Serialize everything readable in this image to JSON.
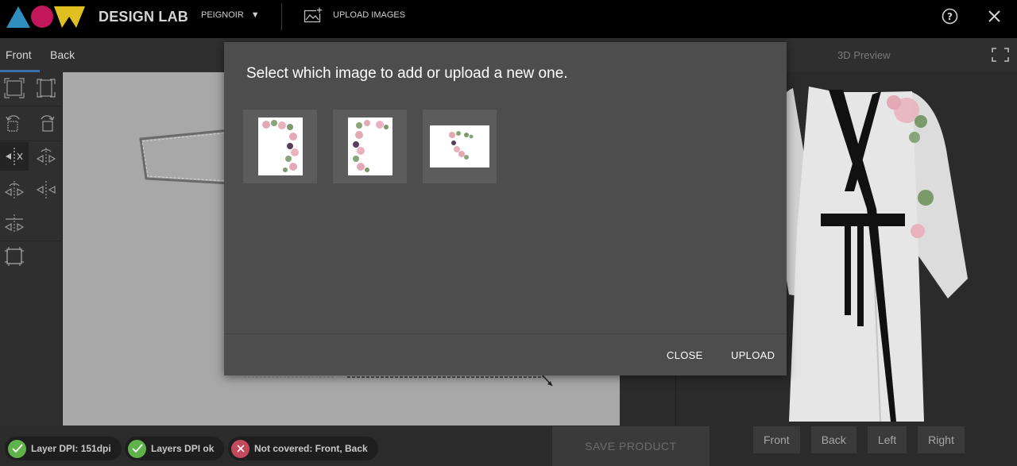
{
  "app": {
    "brand": "DESIGN LAB",
    "product": "PEIGNOIR",
    "upload_images": "UPLOAD IMAGES"
  },
  "tabs": [
    {
      "label": "Front",
      "active": true
    },
    {
      "label": "Back",
      "active": false
    }
  ],
  "preview": {
    "title": "3D Preview",
    "views": [
      "Front",
      "Back",
      "Left",
      "Right"
    ]
  },
  "status": [
    {
      "label": "Layer DPI: 151dpi",
      "state": "ok"
    },
    {
      "label": "Layers DPI ok",
      "state": "ok"
    },
    {
      "label": "Not covered: Front, Back",
      "state": "error"
    }
  ],
  "save_button": "SAVE PRODUCT",
  "modal": {
    "title": "Select which image to add or upload a new one.",
    "close_label": "CLOSE",
    "upload_label": "UPLOAD"
  },
  "colors": {
    "topbar": "#000000",
    "accent_tab": "#3b6fa8",
    "ok": "#5fb34a",
    "error": "#c24a5c",
    "logo_triangle": "#2f8fbf",
    "logo_circle": "#c2185b",
    "logo_w": "#e0c020"
  },
  "icons": {
    "help": "help-circle-icon",
    "close": "close-icon",
    "upload": "image-upload-icon",
    "fullscreen": "fullscreen-icon"
  }
}
